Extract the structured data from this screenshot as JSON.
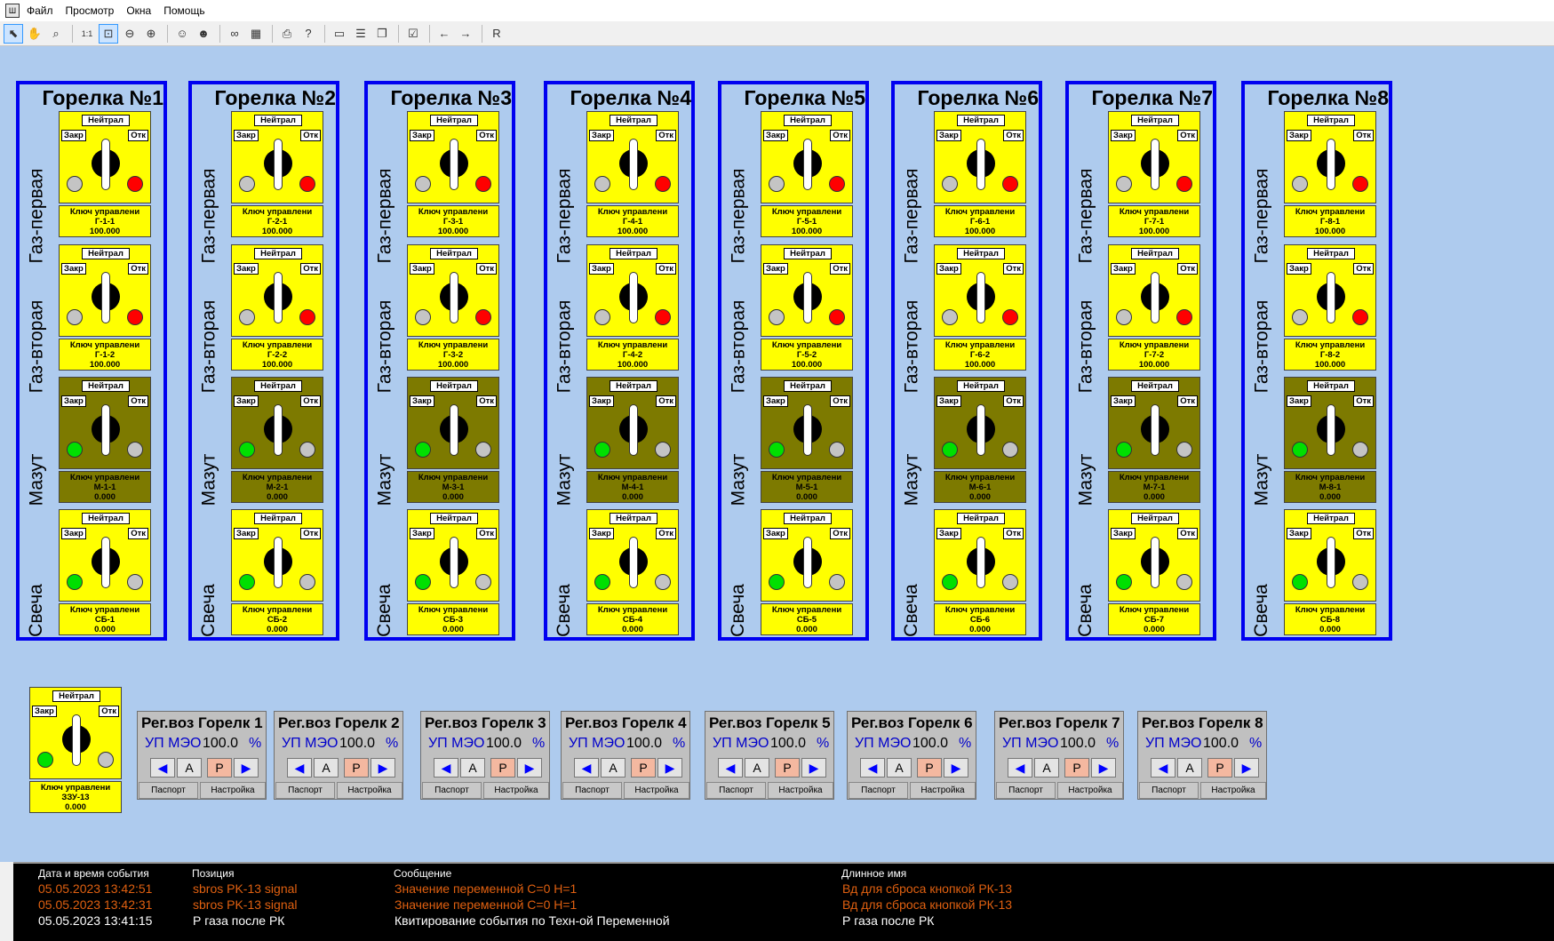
{
  "menu": {
    "items": [
      "Файл",
      "Просмотр",
      "Окна",
      "Помощь"
    ]
  },
  "toolbar": {
    "tools": [
      "arrow-pointer-icon",
      "hand-icon",
      "magnifier-icon",
      "actual-size-icon",
      "zoom-fit-icon",
      "zoom-out-icon",
      "zoom-in-icon",
      "users-icon",
      "user-icon",
      "binoculars-icon",
      "table-icon",
      "print-icon",
      "help-icon",
      "window-icon",
      "layout-icon",
      "windows-icon",
      "checklist-icon",
      "back-arrow-icon",
      "forward-arrow-icon",
      "r-icon"
    ],
    "r_label": "R"
  },
  "switch_labels": {
    "neutral": "Нейтрал",
    "close": "Закр",
    "open": "Отк",
    "key": "Ключ управлени"
  },
  "row_labels": [
    "Газ-первая",
    "Газ-вторая",
    "Мазут",
    "Свеча"
  ],
  "burners": [
    {
      "title": "Горелка №1",
      "switches": [
        {
          "tag": "Г-1-1",
          "value": "100.000",
          "bg": "yellow",
          "left_led": "grey",
          "right_led": "red"
        },
        {
          "tag": "Г-1-2",
          "value": "100.000",
          "bg": "yellow",
          "left_led": "grey",
          "right_led": "red"
        },
        {
          "tag": "М-1-1",
          "value": "0.000",
          "bg": "olive",
          "left_led": "green",
          "right_led": "grey"
        },
        {
          "tag": "СБ-1",
          "value": "0.000",
          "bg": "yellow",
          "left_led": "green",
          "right_led": "grey"
        }
      ]
    },
    {
      "title": "Горелка №2",
      "switches": [
        {
          "tag": "Г-2-1",
          "value": "100.000",
          "bg": "yellow",
          "left_led": "grey",
          "right_led": "red"
        },
        {
          "tag": "Г-2-2",
          "value": "100.000",
          "bg": "yellow",
          "left_led": "grey",
          "right_led": "red"
        },
        {
          "tag": "М-2-1",
          "value": "0.000",
          "bg": "olive",
          "left_led": "green",
          "right_led": "grey"
        },
        {
          "tag": "СБ-2",
          "value": "0.000",
          "bg": "yellow",
          "left_led": "green",
          "right_led": "grey"
        }
      ]
    },
    {
      "title": "Горелка №3",
      "switches": [
        {
          "tag": "Г-3-1",
          "value": "100.000",
          "bg": "yellow",
          "left_led": "grey",
          "right_led": "red"
        },
        {
          "tag": "Г-3-2",
          "value": "100.000",
          "bg": "yellow",
          "left_led": "grey",
          "right_led": "red"
        },
        {
          "tag": "М-3-1",
          "value": "0.000",
          "bg": "olive",
          "left_led": "green",
          "right_led": "grey"
        },
        {
          "tag": "СБ-3",
          "value": "0.000",
          "bg": "yellow",
          "left_led": "green",
          "right_led": "grey"
        }
      ]
    },
    {
      "title": "Горелка №4",
      "switches": [
        {
          "tag": "Г-4-1",
          "value": "100.000",
          "bg": "yellow",
          "left_led": "grey",
          "right_led": "red"
        },
        {
          "tag": "Г-4-2",
          "value": "100.000",
          "bg": "yellow",
          "left_led": "grey",
          "right_led": "red"
        },
        {
          "tag": "М-4-1",
          "value": "0.000",
          "bg": "olive",
          "left_led": "green",
          "right_led": "grey"
        },
        {
          "tag": "СБ-4",
          "value": "0.000",
          "bg": "yellow",
          "left_led": "green",
          "right_led": "grey"
        }
      ]
    },
    {
      "title": "Горелка №5",
      "switches": [
        {
          "tag": "Г-5-1",
          "value": "100.000",
          "bg": "yellow",
          "left_led": "grey",
          "right_led": "red"
        },
        {
          "tag": "Г-5-2",
          "value": "100.000",
          "bg": "yellow",
          "left_led": "grey",
          "right_led": "red"
        },
        {
          "tag": "М-5-1",
          "value": "0.000",
          "bg": "olive",
          "left_led": "green",
          "right_led": "grey"
        },
        {
          "tag": "СБ-5",
          "value": "0.000",
          "bg": "yellow",
          "left_led": "green",
          "right_led": "grey"
        }
      ]
    },
    {
      "title": "Горелка №6",
      "switches": [
        {
          "tag": "Г-6-1",
          "value": "100.000",
          "bg": "yellow",
          "left_led": "grey",
          "right_led": "red"
        },
        {
          "tag": "Г-6-2",
          "value": "100.000",
          "bg": "yellow",
          "left_led": "grey",
          "right_led": "red"
        },
        {
          "tag": "М-6-1",
          "value": "0.000",
          "bg": "olive",
          "left_led": "green",
          "right_led": "grey"
        },
        {
          "tag": "СБ-6",
          "value": "0.000",
          "bg": "yellow",
          "left_led": "green",
          "right_led": "grey"
        }
      ]
    },
    {
      "title": "Горелка №7",
      "switches": [
        {
          "tag": "Г-7-1",
          "value": "100.000",
          "bg": "yellow",
          "left_led": "grey",
          "right_led": "red"
        },
        {
          "tag": "Г-7-2",
          "value": "100.000",
          "bg": "yellow",
          "left_led": "grey",
          "right_led": "red"
        },
        {
          "tag": "М-7-1",
          "value": "0.000",
          "bg": "olive",
          "left_led": "green",
          "right_led": "grey"
        },
        {
          "tag": "СБ-7",
          "value": "0.000",
          "bg": "yellow",
          "left_led": "green",
          "right_led": "grey"
        }
      ]
    },
    {
      "title": "Горелка №8",
      "switches": [
        {
          "tag": "Г-8-1",
          "value": "100.000",
          "bg": "yellow",
          "left_led": "grey",
          "right_led": "red"
        },
        {
          "tag": "Г-8-2",
          "value": "100.000",
          "bg": "yellow",
          "left_led": "grey",
          "right_led": "red"
        },
        {
          "tag": "М-8-1",
          "value": "0.000",
          "bg": "olive",
          "left_led": "green",
          "right_led": "grey"
        },
        {
          "tag": "СБ-8",
          "value": "0.000",
          "bg": "yellow",
          "left_led": "green",
          "right_led": "grey"
        }
      ]
    }
  ],
  "standalone_switch": {
    "tag": "ЗЗУ-13",
    "value": "0.000",
    "bg": "yellow",
    "left_led": "green",
    "right_led": "grey"
  },
  "regulators": {
    "umeo_label": "УП МЭО",
    "pct": "%",
    "a_label": "А",
    "p_label": "Р",
    "passport": "Паспорт",
    "settings": "Настройка",
    "items": [
      {
        "title": "Рег.воз Горелк 1",
        "value": "100.0"
      },
      {
        "title": "Рег.воз Горелк 2",
        "value": "100.0"
      },
      {
        "title": "Рег.воз Горелк 3",
        "value": "100.0"
      },
      {
        "title": "Рег.воз Горелк 4",
        "value": "100.0"
      },
      {
        "title": "Рег.воз Горелк 5",
        "value": "100.0"
      },
      {
        "title": "Рег.воз Горелк 6",
        "value": "100.0"
      },
      {
        "title": "Рег.воз Горелк 7",
        "value": "100.0"
      },
      {
        "title": "Рег.воз Горелк 8",
        "value": "100.0"
      }
    ]
  },
  "events": {
    "headers": {
      "datetime": "Дата и время события",
      "position": "Позиция",
      "message": "Сообщение",
      "long_name": "Длинное имя"
    },
    "rows": [
      {
        "datetime": "05.05.2023 13:42:51",
        "position": "sbros PK-13 signal",
        "message": "Значение переменной C=0  H=1",
        "long_name": "Вд для сброса кнопкой РК-13",
        "kind": "alarm"
      },
      {
        "datetime": "05.05.2023 13:42:31",
        "position": "sbros PK-13 signal",
        "message": "Значение переменной C=0  H=1",
        "long_name": "Вд для сброса кнопкой РК-13",
        "kind": "alarm"
      },
      {
        "datetime": "05.05.2023 13:41:15",
        "position": "Р газа после РК",
        "message": "Квитирование события по Техн-ой Переменной",
        "long_name": "Р газа после РК",
        "kind": "norm"
      }
    ]
  },
  "colors": {
    "frame": "#0000f0",
    "background": "#aecbee",
    "yellow": "#ffff00",
    "olive": "#7d7a00",
    "led_red": "#ff0000",
    "led_green": "#00e000",
    "led_grey": "#c4c4c4",
    "event_alarm": "#e06010"
  }
}
